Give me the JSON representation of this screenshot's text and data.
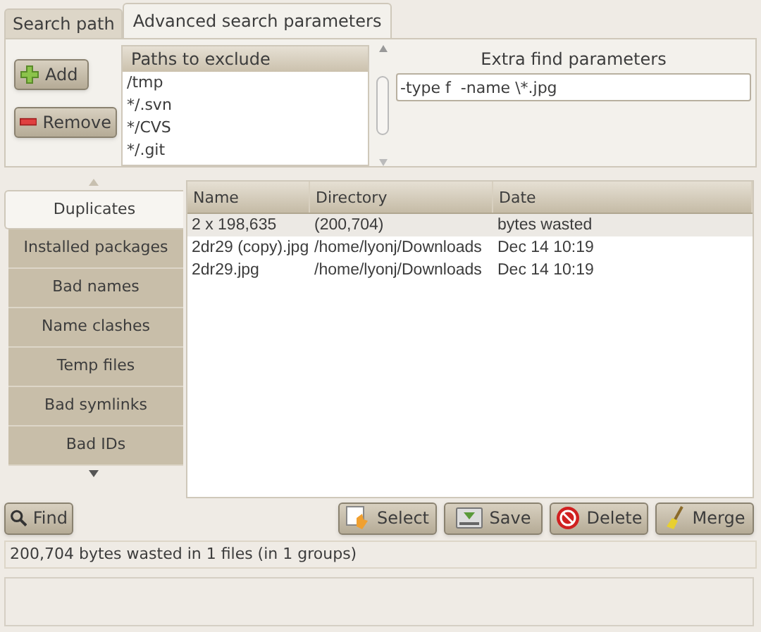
{
  "tabs": [
    {
      "label": "Search path",
      "selected": false
    },
    {
      "label": "Advanced search parameters",
      "selected": true
    }
  ],
  "exclude": {
    "add_button": "Add",
    "remove_button": "Remove",
    "header": "Paths to exclude",
    "paths": [
      "/tmp",
      "*/.svn",
      "*/CVS",
      "*/.git"
    ]
  },
  "extra_find": {
    "label": "Extra find parameters",
    "value": "-type f  -name \\*.jpg"
  },
  "sidebar": {
    "items": [
      {
        "label": "Duplicates",
        "selected": true
      },
      {
        "label": "Installed packages",
        "selected": false
      },
      {
        "label": "Bad names",
        "selected": false
      },
      {
        "label": "Name clashes",
        "selected": false
      },
      {
        "label": "Temp files",
        "selected": false
      },
      {
        "label": "Bad symlinks",
        "selected": false
      },
      {
        "label": "Bad IDs",
        "selected": false
      }
    ]
  },
  "table": {
    "columns": [
      "Name",
      "Directory",
      "Date"
    ],
    "rows": [
      {
        "kind": "group",
        "cells": [
          "2 x 198,635",
          "(200,704)",
          "bytes wasted"
        ]
      },
      {
        "kind": "file",
        "cells": [
          "2dr29 (copy).jpg",
          "/home/lyonj/Downloads",
          "Dec 14 10:19"
        ]
      },
      {
        "kind": "file",
        "cells": [
          "2dr29.jpg",
          "/home/lyonj/Downloads",
          "Dec 14 10:19"
        ]
      }
    ]
  },
  "buttons": {
    "find": "Find",
    "actions": [
      {
        "kind": "select",
        "label": "Select"
      },
      {
        "kind": "save",
        "label": "Save"
      },
      {
        "kind": "delete",
        "label": "Delete"
      },
      {
        "kind": "merge",
        "label": "Merge"
      }
    ]
  },
  "status_bar": "200,704 bytes wasted in 1 files (in 1 groups)"
}
